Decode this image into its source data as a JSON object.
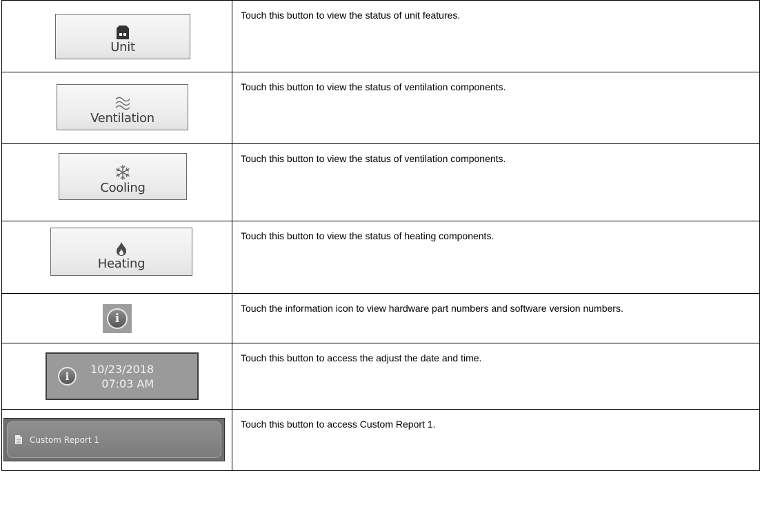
{
  "rows": [
    {
      "button_label": "Unit",
      "icon": "building-icon",
      "description": "Touch this button to view the status of unit features."
    },
    {
      "button_label": "Ventilation",
      "icon": "airflow-icon",
      "description": "Touch this button to view the status of ventilation components."
    },
    {
      "button_label": "Cooling",
      "icon": "snowflake-icon",
      "description": "Touch this button to view the status of ventilation components."
    },
    {
      "button_label": "Heating",
      "icon": "flame-icon",
      "description": "Touch this button to view the status of heating components."
    },
    {
      "icon": "info-icon",
      "description": "Touch the information icon to view hardware part numbers and software version numbers."
    },
    {
      "date": "10/23/2018",
      "time": "07:03 AM",
      "icon": "info-icon",
      "description": "Touch this button to access the adjust the date and time."
    },
    {
      "button_label": "Custom Report 1",
      "icon": "document-icon",
      "description": "Touch this button to access Custom Report 1."
    }
  ]
}
